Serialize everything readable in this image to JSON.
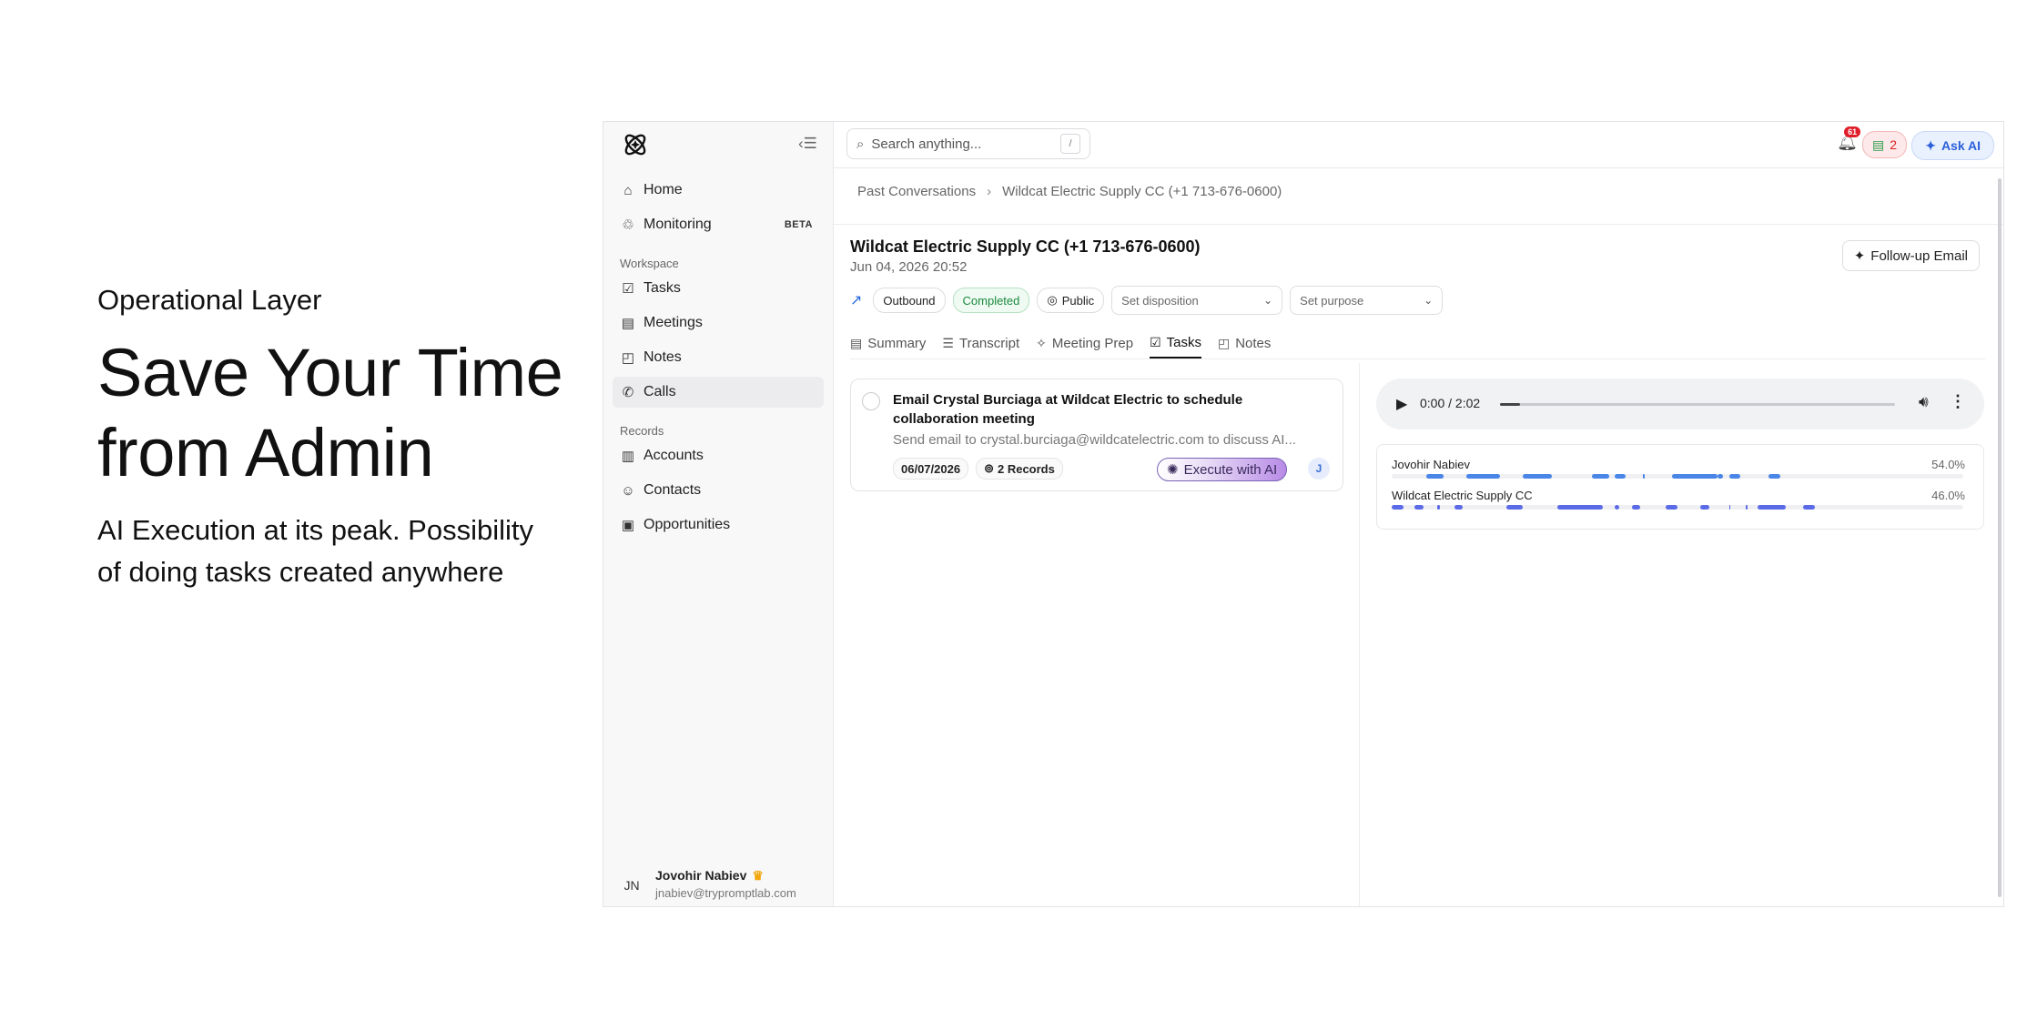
{
  "hero": {
    "eyebrow": "Operational Layer",
    "headline_line1": "Save Your Time",
    "headline_line2": "from Admin",
    "sub_line1": "AI Execution at its peak. Possibility",
    "sub_line2": "of doing tasks created anywhere"
  },
  "sidebar": {
    "nav": [
      {
        "label": "Home",
        "icon": "home-icon"
      },
      {
        "label": "Monitoring",
        "icon": "monitoring-icon",
        "badge": "BETA"
      }
    ],
    "workspace_label": "Workspace",
    "workspace": [
      {
        "label": "Tasks",
        "icon": "checkbox-icon"
      },
      {
        "label": "Meetings",
        "icon": "calendar-icon"
      },
      {
        "label": "Notes",
        "icon": "note-icon"
      },
      {
        "label": "Calls",
        "icon": "phone-icon",
        "active": true
      }
    ],
    "records_label": "Records",
    "records": [
      {
        "label": "Accounts",
        "icon": "building-icon"
      },
      {
        "label": "Contacts",
        "icon": "contacts-icon"
      },
      {
        "label": "Opportunities",
        "icon": "briefcase-icon"
      }
    ],
    "user": {
      "initials": "JN",
      "name": "Jovohir Nabiev",
      "email": "jnabiev@trypromptlab.com"
    }
  },
  "topbar": {
    "search_placeholder": "Search anything...",
    "search_shortcut": "/",
    "notification_count": "61",
    "usage_count": "2",
    "ask_ai": "Ask AI"
  },
  "breadcrumb": {
    "parent": "Past Conversations",
    "separator": "›",
    "current": "Wildcat Electric Supply CC (+1 713-676-0600)"
  },
  "conversation": {
    "title": "Wildcat Electric Supply CC (+1 713-676-0600)",
    "date": "Jun 04, 2026 20:52",
    "followup_label": "Follow-up Email",
    "direction": "Outbound",
    "status": "Completed",
    "visibility": "Public",
    "disposition_placeholder": "Set disposition",
    "purpose_placeholder": "Set purpose",
    "accent_color": "#2b6be0",
    "status_color": "#1b8a3e"
  },
  "tabs": [
    {
      "label": "Summary",
      "icon": "summary-icon"
    },
    {
      "label": "Transcript",
      "icon": "transcript-icon"
    },
    {
      "label": "Meeting Prep",
      "icon": "sparkle-icon"
    },
    {
      "label": "Tasks",
      "icon": "checkbox-icon",
      "active": true
    },
    {
      "label": "Notes",
      "icon": "note-icon"
    }
  ],
  "task": {
    "title": "Email Crystal Burciaga at Wildcat Electric to schedule collaboration meeting",
    "description": "Send email to crystal.burciaga@wildcatelectric.com to discuss AI...",
    "due_date": "06/07/2026",
    "records": "2 Records",
    "execute_label": "Execute with AI",
    "assignee_initial": "J"
  },
  "player": {
    "time": "0:00 / 2:02",
    "progress": 0.05
  },
  "speakers": [
    {
      "name": "Jovohir Nabiev",
      "percent": "54.0%",
      "color": "#4a86e8",
      "segments": [
        [
          0.06,
          0.03
        ],
        [
          0.08,
          0.01
        ],
        [
          0.13,
          0.06
        ],
        [
          0.23,
          0.05
        ],
        [
          0.35,
          0.03
        ],
        [
          0.39,
          0.02
        ],
        [
          0.44,
          0.003
        ],
        [
          0.49,
          0.08
        ],
        [
          0.57,
          0.01
        ],
        [
          0.59,
          0.02
        ],
        [
          0.66,
          0.02
        ]
      ]
    },
    {
      "name": "Wildcat Electric Supply CC",
      "percent": "46.0%",
      "color": "#5b6be8",
      "segments": [
        [
          0.0,
          0.02
        ],
        [
          0.04,
          0.015
        ],
        [
          0.08,
          0.005
        ],
        [
          0.11,
          0.015
        ],
        [
          0.2,
          0.03
        ],
        [
          0.29,
          0.08
        ],
        [
          0.39,
          0.008
        ],
        [
          0.42,
          0.015
        ],
        [
          0.48,
          0.02
        ],
        [
          0.54,
          0.015
        ],
        [
          0.59,
          0.003
        ],
        [
          0.62,
          0.002
        ],
        [
          0.64,
          0.05
        ],
        [
          0.72,
          0.02
        ]
      ]
    }
  ]
}
